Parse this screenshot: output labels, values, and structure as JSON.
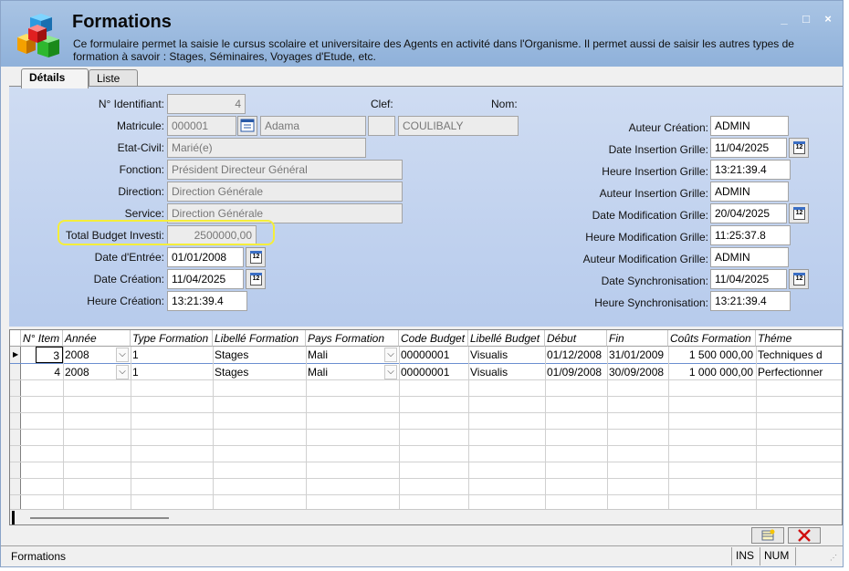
{
  "window": {
    "title": "Formations",
    "description": "Ce formulaire permet la saisie le cursus scolaire et universitaire des Agents en activité dans l'Organisme. Il permet aussi de saisir les autres types de formation à savoir : Stages, Séminaires, Voyages d'Etude, etc.",
    "minimize": "_",
    "maximize": "□",
    "close": "×"
  },
  "tabs": [
    {
      "label": "Détails",
      "active": true
    },
    {
      "label": "Liste",
      "active": false
    }
  ],
  "form": {
    "identifiant_label": "N° Identifiant:",
    "identifiant": "4",
    "clef_label": "Clef:",
    "nom_label": "Nom:",
    "matricule_label": "Matricule:",
    "matricule": "000001",
    "prenom": "Adama",
    "nom": "COULIBALY",
    "etat_civil_label": "Etat-Civil:",
    "etat_civil": "Marié(e)",
    "fonction_label": "Fonction:",
    "fonction": "Président Directeur Général",
    "direction_label": "Direction:",
    "direction": "Direction Générale",
    "service_label": "Service:",
    "service": "Direction Générale",
    "budget_label": "Total Budget Investi:",
    "budget": "2500000,00",
    "date_entree_label": "Date d'Entrée:",
    "date_entree": "01/01/2008",
    "date_creation_label": "Date Création:",
    "date_creation": "11/04/2025",
    "heure_creation_label": "Heure Création:",
    "heure_creation": "13:21:39.4",
    "calendar_glyph": "12"
  },
  "audit": {
    "auteur_creation_label": "Auteur Création:",
    "auteur_creation": "ADMIN",
    "date_insertion_label": "Date Insertion Grille:",
    "date_insertion": "11/04/2025",
    "heure_insertion_label": "Heure Insertion Grille:",
    "heure_insertion": "13:21:39.4",
    "auteur_insertion_label": "Auteur Insertion Grille:",
    "auteur_insertion": "ADMIN",
    "date_modification_label": "Date Modification Grille:",
    "date_modification": "20/04/2025",
    "heure_modification_label": "Heure Modification Grille:",
    "heure_modification": "11:25:37.8",
    "auteur_modification_label": "Auteur Modification Grille:",
    "auteur_modification": "ADMIN",
    "date_sync_label": "Date Synchronisation:",
    "date_sync": "11/04/2025",
    "heure_sync_label": "Heure Synchronisation:",
    "heure_sync": "13:21:39.4"
  },
  "grid": {
    "columns": [
      "N° Item",
      "Année",
      "Type Formation",
      "Libellé Formation",
      "Pays Formation",
      "Code Budget",
      "Libellé Budget",
      "Début",
      "Fin",
      "Coûts Formation",
      "Théme"
    ],
    "rows": [
      [
        "3",
        "2008",
        "1",
        "Stages",
        "Mali",
        "00000001",
        "Visualis",
        "01/12/2008",
        "31/01/2009",
        "1 500 000,00",
        "Techniques d"
      ],
      [
        "4",
        "2008",
        "1",
        "Stages",
        "Mali",
        "00000001",
        "Visualis",
        "01/09/2008",
        "30/09/2008",
        "1 000 000,00",
        "Perfectionner"
      ]
    ]
  },
  "statusbar": {
    "text": "Formations",
    "ins": "INS",
    "num": "NUM"
  },
  "colors": {
    "titlebar": "#a9c4e4",
    "form_bg": "#c4d4ee",
    "highlight": "#f5ee3a",
    "delete_red": "#d01010"
  }
}
